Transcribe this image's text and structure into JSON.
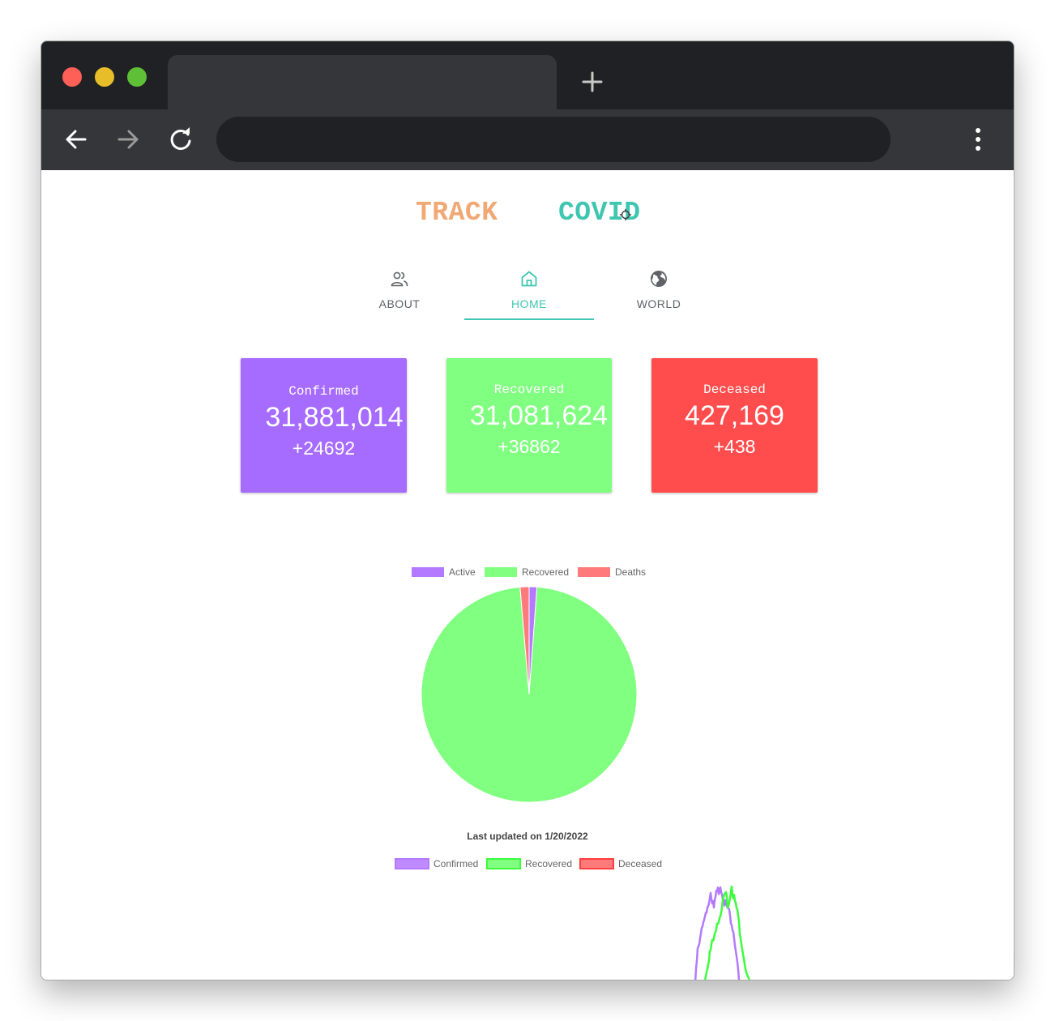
{
  "browser": {
    "new_tab_icon": "plus-icon",
    "back_icon": "arrow-left-icon",
    "forward_icon": "arrow-right-icon",
    "reload_icon": "reload-icon",
    "menu_icon": "more-vertical-icon"
  },
  "header": {
    "logo_left": "TRACK",
    "logo_right": "COVID",
    "emblem_icon": "virus-icon"
  },
  "nav": {
    "items": [
      {
        "label": "ABOUT",
        "icon": "people-icon",
        "active": false
      },
      {
        "label": "HOME",
        "icon": "home-icon",
        "active": true
      },
      {
        "label": "WORLD",
        "icon": "globe-icon",
        "active": false
      }
    ],
    "accent_color": "#3fc6b0"
  },
  "stats": {
    "confirmed": {
      "title": "Confirmed",
      "value": "31,881,014",
      "delta": "+24692",
      "color": "#a66bff"
    },
    "recovered": {
      "title": "Recovered",
      "value": "31,081,624",
      "delta": "+36862",
      "color": "#80ff80"
    },
    "deceased": {
      "title": "Deceased",
      "value": "427,169",
      "delta": "+438",
      "color": "#ff4c4c"
    }
  },
  "last_updated": "Last updated on 1/20/2022",
  "chart_data": [
    {
      "type": "pie",
      "legend_position": "top",
      "labels": [
        "Active",
        "Recovered",
        "Deaths"
      ],
      "values": [
        372221,
        31081624,
        427169
      ],
      "colors": [
        "#b379ff",
        "#80ff80",
        "#ff7a7a"
      ]
    },
    {
      "type": "line",
      "legend_position": "top",
      "series": [
        {
          "name": "Confirmed",
          "color": "#b379ff"
        },
        {
          "name": "Recovered",
          "color": "#3cff3c"
        },
        {
          "name": "Deceased",
          "color": "#ff4040"
        }
      ]
    }
  ]
}
